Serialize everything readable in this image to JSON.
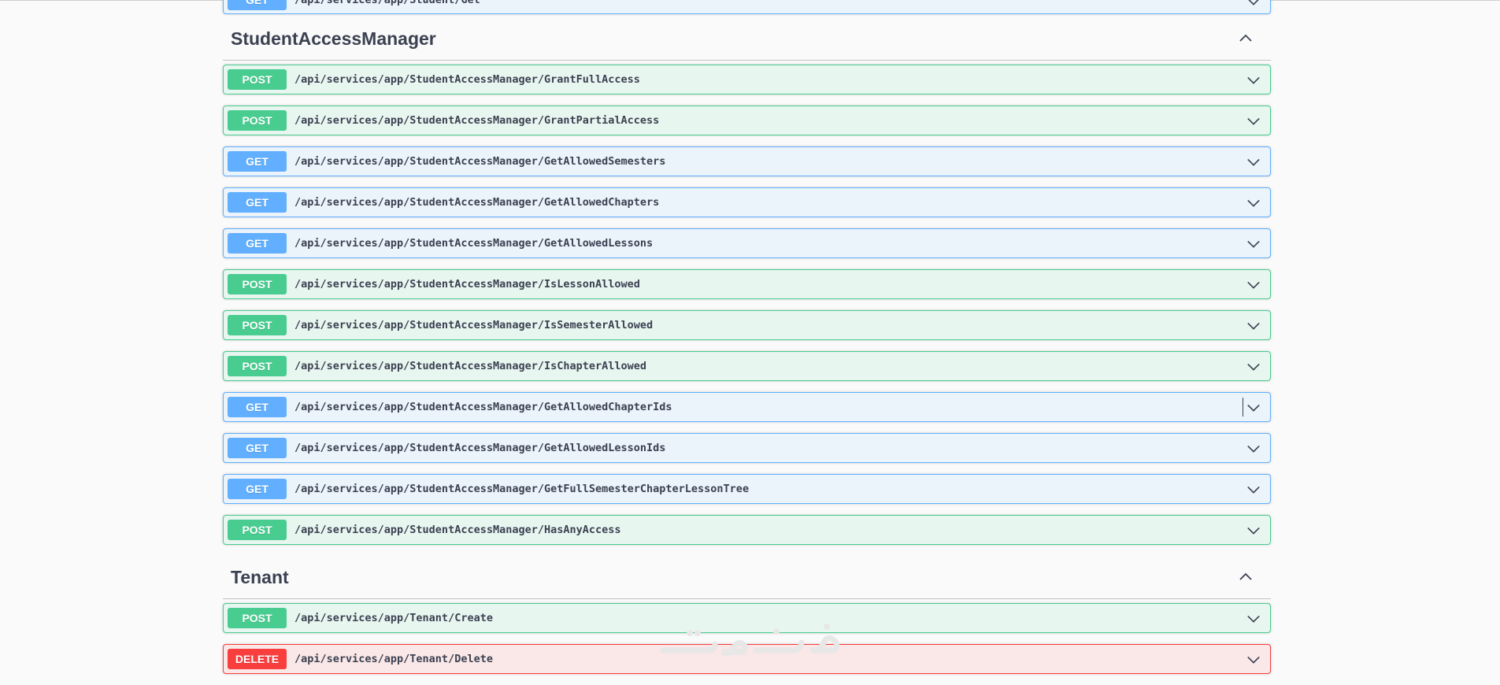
{
  "top_partial": {
    "method": "GET",
    "path": "/api/services/app/Student/Get"
  },
  "sections": [
    {
      "title": "StudentAccessManager",
      "operations": [
        {
          "method": "POST",
          "path": "/api/services/app/StudentAccessManager/GrantFullAccess"
        },
        {
          "method": "POST",
          "path": "/api/services/app/StudentAccessManager/GrantPartialAccess"
        },
        {
          "method": "GET",
          "path": "/api/services/app/StudentAccessManager/GetAllowedSemesters"
        },
        {
          "method": "GET",
          "path": "/api/services/app/StudentAccessManager/GetAllowedChapters"
        },
        {
          "method": "GET",
          "path": "/api/services/app/StudentAccessManager/GetAllowedLessons"
        },
        {
          "method": "POST",
          "path": "/api/services/app/StudentAccessManager/IsLessonAllowed"
        },
        {
          "method": "POST",
          "path": "/api/services/app/StudentAccessManager/IsSemesterAllowed"
        },
        {
          "method": "POST",
          "path": "/api/services/app/StudentAccessManager/IsChapterAllowed"
        },
        {
          "method": "GET",
          "path": "/api/services/app/StudentAccessManager/GetAllowedChapterIds"
        },
        {
          "method": "GET",
          "path": "/api/services/app/StudentAccessManager/GetAllowedLessonIds"
        },
        {
          "method": "GET",
          "path": "/api/services/app/StudentAccessManager/GetFullSemesterChapterLessonTree"
        },
        {
          "method": "POST",
          "path": "/api/services/app/StudentAccessManager/HasAnyAccess"
        }
      ]
    },
    {
      "title": "Tenant",
      "operations": [
        {
          "method": "POST",
          "path": "/api/services/app/Tenant/Create"
        },
        {
          "method": "DELETE",
          "path": "/api/services/app/Tenant/Delete"
        }
      ]
    }
  ],
  "icons": {
    "expand": "chevron-down-icon",
    "collapse": "chevron-up-icon"
  },
  "colors": {
    "get": "#61affe",
    "post": "#49cc90",
    "delete": "#f93e3e",
    "text": "#3b4151"
  },
  "watermark_text": "خکسات"
}
